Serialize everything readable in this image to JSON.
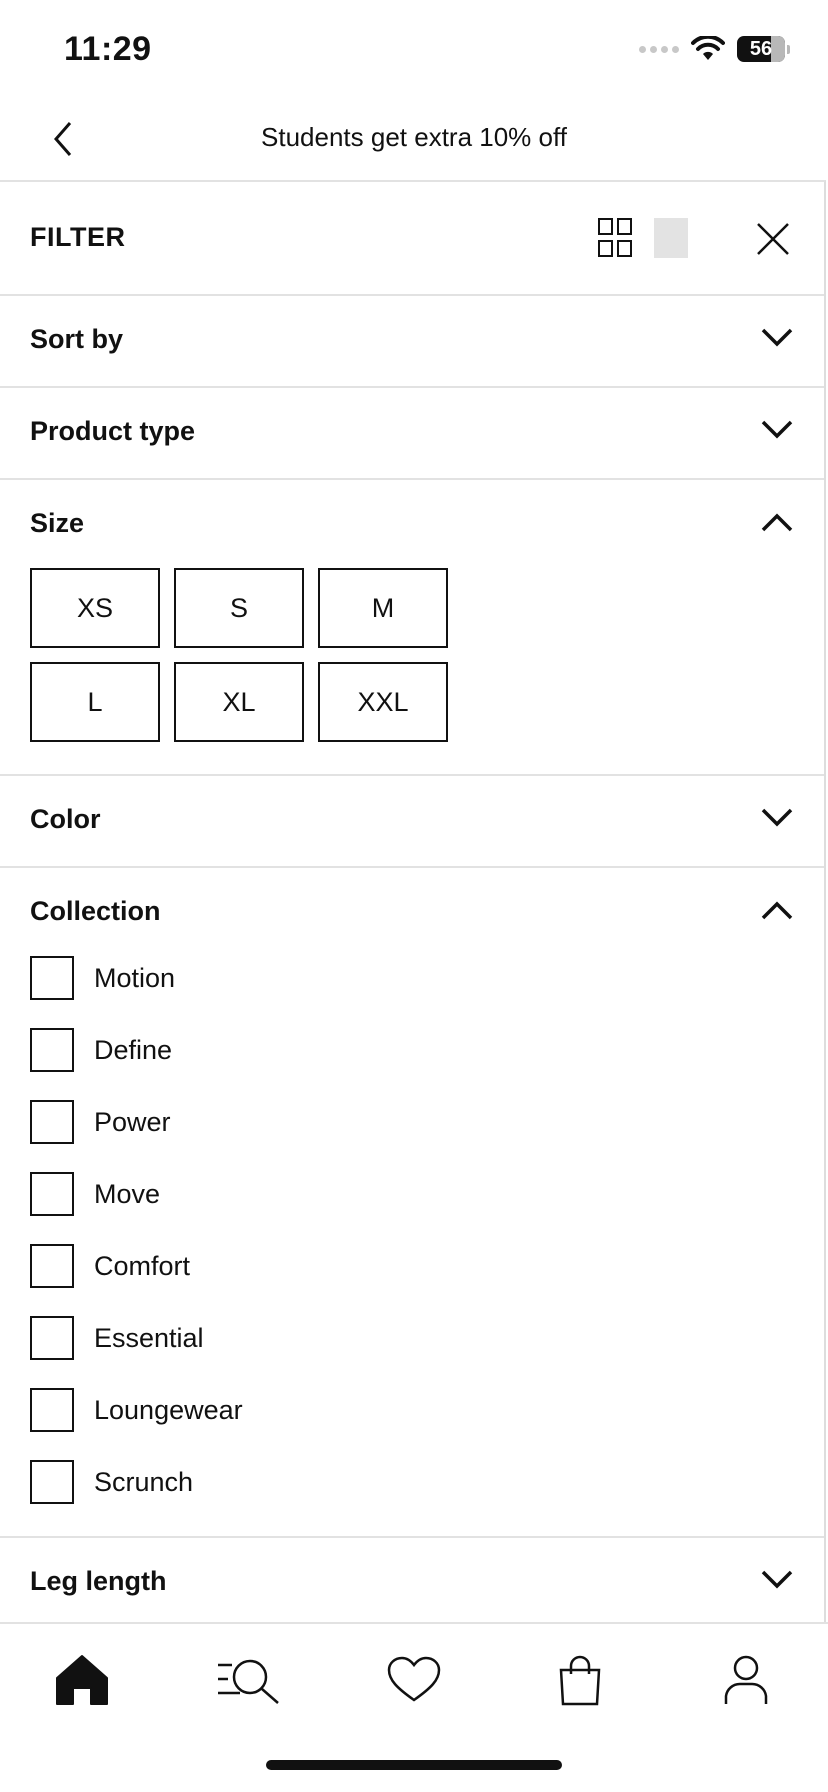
{
  "status_bar": {
    "time": "11:29",
    "battery": "56"
  },
  "header": {
    "promo_text": "Students get extra 10% off"
  },
  "filter": {
    "title": "FILTER"
  },
  "sections": {
    "sort_by": "Sort by",
    "product_type": "Product type",
    "size": "Size",
    "color": "Color",
    "collection": "Collection",
    "leg_length": "Leg length"
  },
  "sizes": [
    "XS",
    "S",
    "M",
    "L",
    "XL",
    "XXL"
  ],
  "collections": [
    "Motion",
    "Define",
    "Power",
    "Move",
    "Comfort",
    "Essential",
    "Loungewear",
    "Scrunch"
  ],
  "icons": {
    "back": "chevron-left-icon",
    "grid_view": "grid-view-icon",
    "single_view": "single-view-icon",
    "close": "close-icon",
    "nav": [
      "home-icon",
      "search-icon",
      "heart-icon",
      "bag-icon",
      "profile-icon"
    ]
  }
}
